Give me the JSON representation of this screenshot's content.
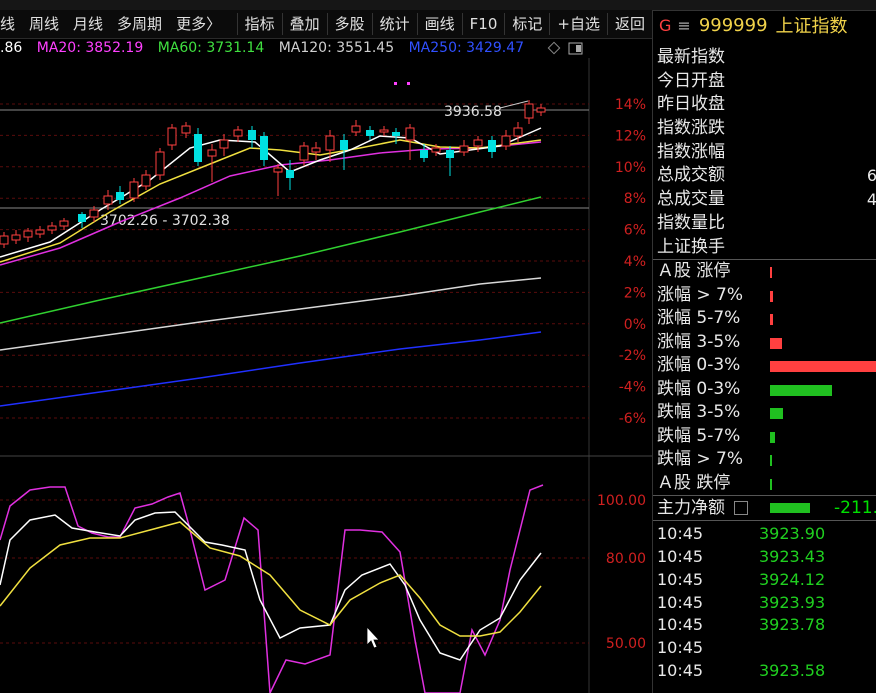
{
  "toolbar": {
    "items": [
      "线",
      "周线",
      "月线",
      "多周期",
      "更多〉"
    ],
    "right_items": [
      "指标",
      "叠加",
      "多股",
      "统计",
      "画线",
      "F10",
      "标记",
      "+自选",
      "返回"
    ]
  },
  "ma_legend": [
    {
      "label": ".86",
      "color": "#ffffff"
    },
    {
      "label": "MA20: 3852.19",
      "color": "#ff40ff"
    },
    {
      "label": "MA60: 3731.14",
      "color": "#40e040"
    },
    {
      "label": "MA120: 3551.45",
      "color": "#d0d0d0"
    },
    {
      "label": "MA250: 3429.47",
      "color": "#3050ff"
    }
  ],
  "price_annotations": {
    "high": "3936.58",
    "range": "3702.26 - 3702.38"
  },
  "pct_axis": [
    "14%",
    "12%",
    "10%",
    "8%",
    "6%",
    "4%",
    "2%",
    "0%",
    "-2%",
    "-4%",
    "-6%"
  ],
  "ind_axis": [
    "100.00",
    "80.00",
    "50.00"
  ],
  "panel": {
    "code": "999999",
    "name": "上证指数",
    "stats": [
      {
        "label": "最新指数",
        "value": ""
      },
      {
        "label": "今日开盘",
        "value": ""
      },
      {
        "label": "昨日收盘",
        "value": ""
      },
      {
        "label": "指数涨跌",
        "value": ""
      },
      {
        "label": "指数涨幅",
        "value": ""
      },
      {
        "label": "总成交额",
        "value": "6"
      },
      {
        "label": "总成交量",
        "value": "4"
      },
      {
        "label": "指数量比",
        "value": ""
      },
      {
        "label": "上证换手",
        "value": ""
      }
    ],
    "distribution": [
      {
        "label": "Ａ股 涨停",
        "fraction": 0.01,
        "color": "#ff4040"
      },
      {
        "label": "涨幅 > 7%",
        "fraction": 0.03,
        "color": "#ff4040"
      },
      {
        "label": "涨幅 5-7%",
        "fraction": 0.03,
        "color": "#ff4040"
      },
      {
        "label": "涨幅 3-5%",
        "fraction": 0.11,
        "color": "#ff4040"
      },
      {
        "label": "涨幅 0-3%",
        "fraction": 1.0,
        "color": "#ff4040"
      },
      {
        "label": "跌幅 0-3%",
        "fraction": 0.58,
        "color": "#20c020"
      },
      {
        "label": "跌幅 3-5%",
        "fraction": 0.12,
        "color": "#20c020"
      },
      {
        "label": "跌幅 5-7%",
        "fraction": 0.05,
        "color": "#20c020"
      },
      {
        "label": "跌幅 > 7%",
        "fraction": 0.01,
        "color": "#20c020"
      },
      {
        "label": "Ａ股 跌停",
        "fraction": 0.01,
        "color": "#20c020"
      }
    ],
    "main_flow": {
      "label": "主力净额",
      "value": "-211."
    },
    "ticks": [
      {
        "time": "10:45",
        "price": "3923.90"
      },
      {
        "time": "10:45",
        "price": "3923.43"
      },
      {
        "time": "10:45",
        "price": "3924.12"
      },
      {
        "time": "10:45",
        "price": "3923.93"
      },
      {
        "time": "10:45",
        "price": "3923.78"
      },
      {
        "time": "10:45",
        "price": ""
      },
      {
        "time": "10:45",
        "price": "3923.58"
      }
    ]
  },
  "colors": {
    "up": "#ff4040",
    "down": "#00e0e0",
    "grid": "#7a1010",
    "axis_text": "#c02020"
  }
}
